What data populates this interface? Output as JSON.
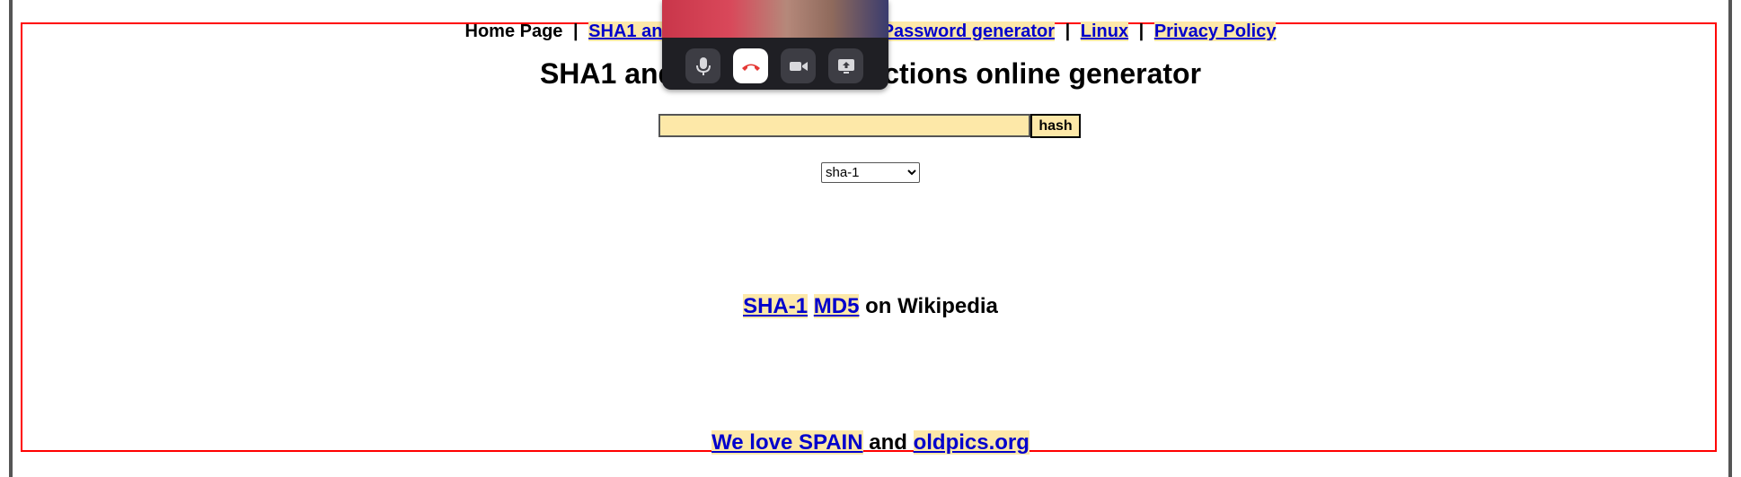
{
  "nav": {
    "home": "Home Page",
    "sep": "|",
    "sha_link": "SHA1 and other hash functions",
    "password_link": "Password generator",
    "linux_link": "Linux",
    "privacy_link": "Privacy Policy"
  },
  "title": "SHA1 and other hash functions online generator",
  "form": {
    "input_value": "",
    "button_label": "hash",
    "algorithm_selected": "sha-1"
  },
  "wiki": {
    "sha1": "SHA-1",
    "md5": "MD5",
    "suffix": " on Wikipedia"
  },
  "footer": {
    "spain": "We love SPAIN",
    "and": " and ",
    "oldpics": "oldpics.org"
  },
  "call": {
    "icons": [
      "microphone-icon",
      "end-call-icon",
      "camera-icon",
      "share-screen-icon"
    ],
    "end_color": "#e53935"
  }
}
